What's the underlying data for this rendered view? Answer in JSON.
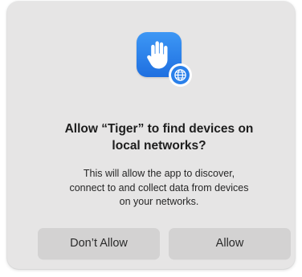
{
  "dialog": {
    "app_icon": "raised-hand-icon",
    "badge_icon": "globe-icon",
    "accent_color": "#2a80ea",
    "title_lines": [
      "Allow “Tiger” to find devices on",
      "local networks?"
    ],
    "message_lines": [
      "This will allow the app to discover,",
      "connect to and collect data from devices",
      "on your networks."
    ],
    "buttons": {
      "deny_label": "Don’t Allow",
      "allow_label": "Allow"
    }
  }
}
